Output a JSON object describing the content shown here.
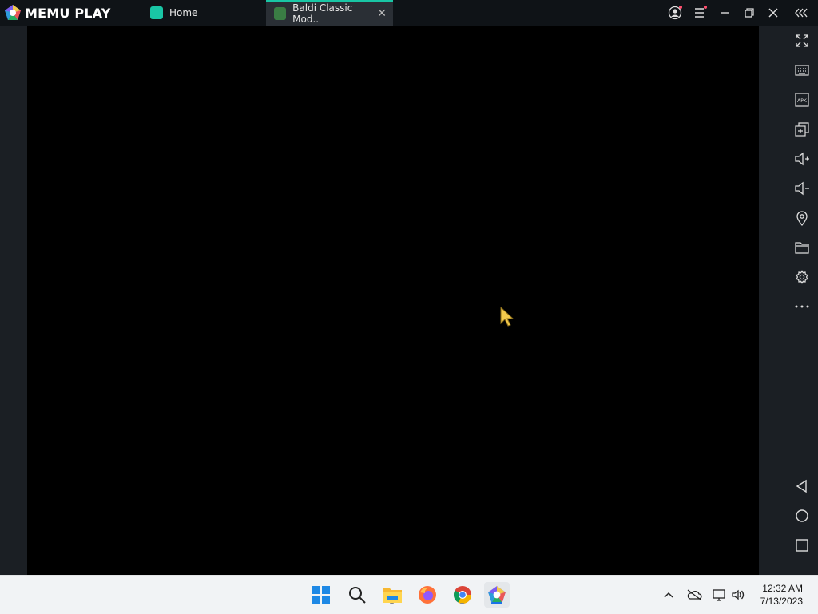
{
  "app": {
    "logo_text": "MEMU PLAY",
    "tabs": [
      {
        "label": "Home",
        "active": false,
        "icon": "memu-home-icon"
      },
      {
        "label": "Baldi Classic Mod..",
        "active": true,
        "icon": "baldi-app-icon"
      }
    ],
    "titlebar_buttons": [
      "account-icon",
      "menu-icon",
      "minimize-icon",
      "restore-icon",
      "close-icon",
      "collapse-sidebar-icon"
    ]
  },
  "sidebar": {
    "top_buttons": [
      "fullscreen-icon",
      "keyboard-icon",
      "apk-icon",
      "multi-instance-icon",
      "volume-up-icon",
      "volume-down-icon",
      "location-icon",
      "folder-icon",
      "settings-icon",
      "more-icon"
    ],
    "bottom_buttons": [
      "back-icon",
      "home-circle-icon",
      "recents-icon"
    ],
    "apk_label": "APK"
  },
  "taskbar": {
    "apps": [
      "windows-start-icon",
      "search-icon",
      "file-explorer-icon",
      "firefox-icon",
      "chrome-icon",
      "memu-icon"
    ],
    "tray": [
      "show-hidden-icons",
      "onedrive-icon",
      "network-icon",
      "speaker-icon"
    ],
    "time": "12:32 AM",
    "date": "7/13/2023"
  },
  "colors": {
    "accent": "#19c6a5",
    "titlebar": "#0f1317",
    "taskbar": "#f1f3f5"
  }
}
